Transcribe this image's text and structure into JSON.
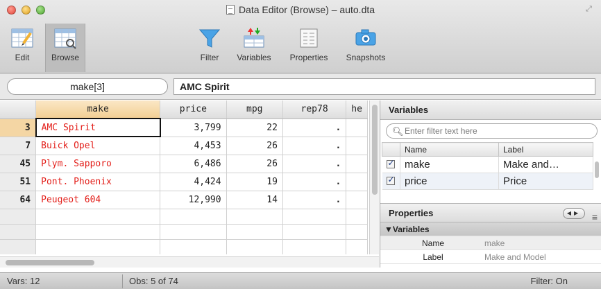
{
  "window": {
    "title": "Data Editor (Browse) – auto.dta"
  },
  "toolbar": {
    "edit_label": "Edit",
    "browse_label": "Browse",
    "filter_label": "Filter",
    "variables_label": "Variables",
    "properties_label": "Properties",
    "snapshots_label": "Snapshots"
  },
  "cellbar": {
    "cell_name": "make[3]",
    "cell_value": "AMC Spirit"
  },
  "grid": {
    "columns": [
      "make",
      "price",
      "mpg",
      "rep78",
      "he"
    ],
    "rows": [
      {
        "obs": "3",
        "make": "AMC Spirit",
        "price": "3,799",
        "mpg": "22",
        "rep78": "."
      },
      {
        "obs": "7",
        "make": "Buick Opel",
        "price": "4,453",
        "mpg": "26",
        "rep78": "."
      },
      {
        "obs": "45",
        "make": "Plym. Sapporo",
        "price": "6,486",
        "mpg": "26",
        "rep78": "."
      },
      {
        "obs": "51",
        "make": "Pont. Phoenix",
        "price": "4,424",
        "mpg": "19",
        "rep78": "."
      },
      {
        "obs": "64",
        "make": "Peugeot 604",
        "price": "12,990",
        "mpg": "14",
        "rep78": "."
      }
    ]
  },
  "variables_panel": {
    "title": "Variables",
    "filter_placeholder": "Enter filter text here",
    "col_name": "Name",
    "col_label": "Label",
    "rows": [
      {
        "name": "make",
        "label": "Make and…"
      },
      {
        "name": "price",
        "label": "Price"
      }
    ]
  },
  "properties_panel": {
    "title": "Properties",
    "group": "▼Variables",
    "rows": [
      {
        "key": "Name",
        "value": "make"
      },
      {
        "key": "Label",
        "value": "Make and Model"
      }
    ]
  },
  "status": {
    "vars": "Vars: 12",
    "obs": "Obs: 5 of 74",
    "filter": "Filter: On"
  },
  "colors": {
    "make_text": "#e3201b",
    "selection_header": "#f2cf94",
    "filter_icon": "#4aa3e6"
  },
  "icons": [
    "edit-grid-icon",
    "browse-grid-icon",
    "filter-funnel-icon",
    "variables-icon",
    "properties-icon",
    "snapshot-camera-icon"
  ]
}
